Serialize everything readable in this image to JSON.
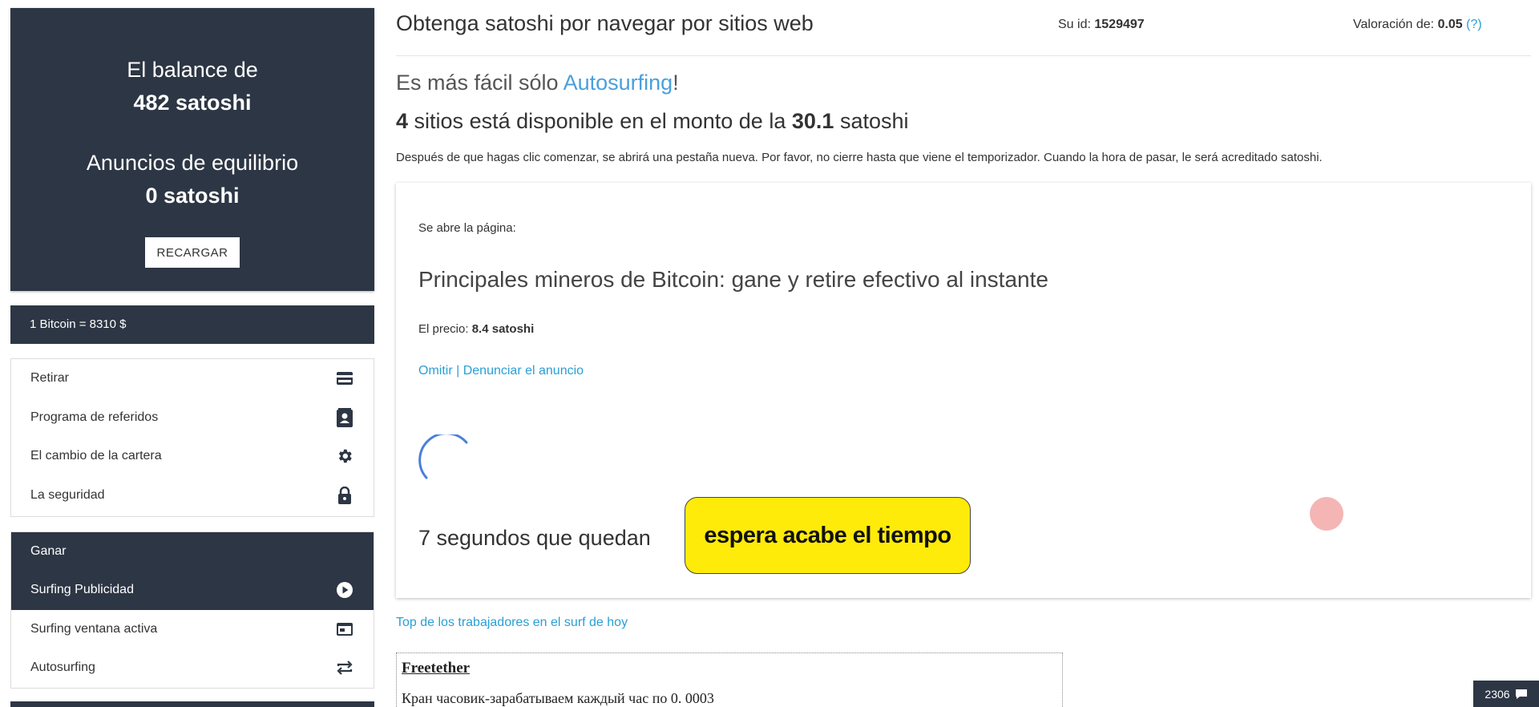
{
  "sidebar": {
    "balance_label": "El balance de",
    "balance_value": "482 satoshi",
    "ads_balance_label": "Anuncios de equilibrio",
    "ads_balance_value": "0 satoshi",
    "reload_label": "RECARGAR",
    "btc_rate": "1 Bitcoin = 8310 $",
    "account_menu": [
      {
        "label": "Retirar",
        "icon": "credit-card-icon"
      },
      {
        "label": "Programa de referidos",
        "icon": "contact-card-icon"
      },
      {
        "label": "El cambio de la cartera",
        "icon": "gear-icon"
      },
      {
        "label": "La seguridad",
        "icon": "lock-icon"
      }
    ],
    "earn_header": "Ganar",
    "earn_menu": [
      {
        "label": "Surfing Publicidad",
        "icon": "play-circle-icon",
        "active": true
      },
      {
        "label": "Surfing ventana activa",
        "icon": "window-icon",
        "active": false
      },
      {
        "label": "Autosurfing",
        "icon": "repeat-icon",
        "active": false
      }
    ]
  },
  "header": {
    "title": "Obtenga satoshi por navegar por sitios web",
    "user_id_label": "Su id:",
    "user_id": "1529497",
    "rating_label": "Valoración de:",
    "rating_value": "0.05",
    "rating_help": "(?)"
  },
  "main": {
    "easier_prefix": "Es más fácil sólo",
    "easier_link": "Autosurfing",
    "easier_suffix": "!",
    "available_count": "4",
    "available_text": "sitios está disponible en el monto de la",
    "available_amount": "30.1",
    "available_unit": "satoshi",
    "instructions": "Después de que hagas clic comenzar, se abrirá una pestaña nueva. Por favor, no cierre hasta que viene el temporizador. Cuando la hora de pasar, le será acreditado satoshi."
  },
  "ad": {
    "opens_label": "Se abre la página:",
    "title": "Principales mineros de Bitcoin: gane y retire efectivo al instante",
    "price_label": "El precio:",
    "price_value": "8.4 satoshi",
    "skip_link": "Omitir",
    "separator": "|",
    "report_link": "Denunciar el anuncio",
    "remaining_text": "7 segundos que quedan",
    "wait_badge": "espera acabe el tiempo"
  },
  "top_workers_link": "Top de los trabajadores en el surf de hoy",
  "ad_box": {
    "title": "Freetether",
    "description": "Кран часовик-зарабатываем каждый час по 0. 0003"
  },
  "chat": {
    "count": "2306",
    "icon": "chat-bubble-icon"
  },
  "colors": {
    "sidebar_bg": "#2d3644",
    "link": "#2a9fd6",
    "badge_yellow": "#ffeb0a",
    "spinner": "#4a7fdc"
  }
}
